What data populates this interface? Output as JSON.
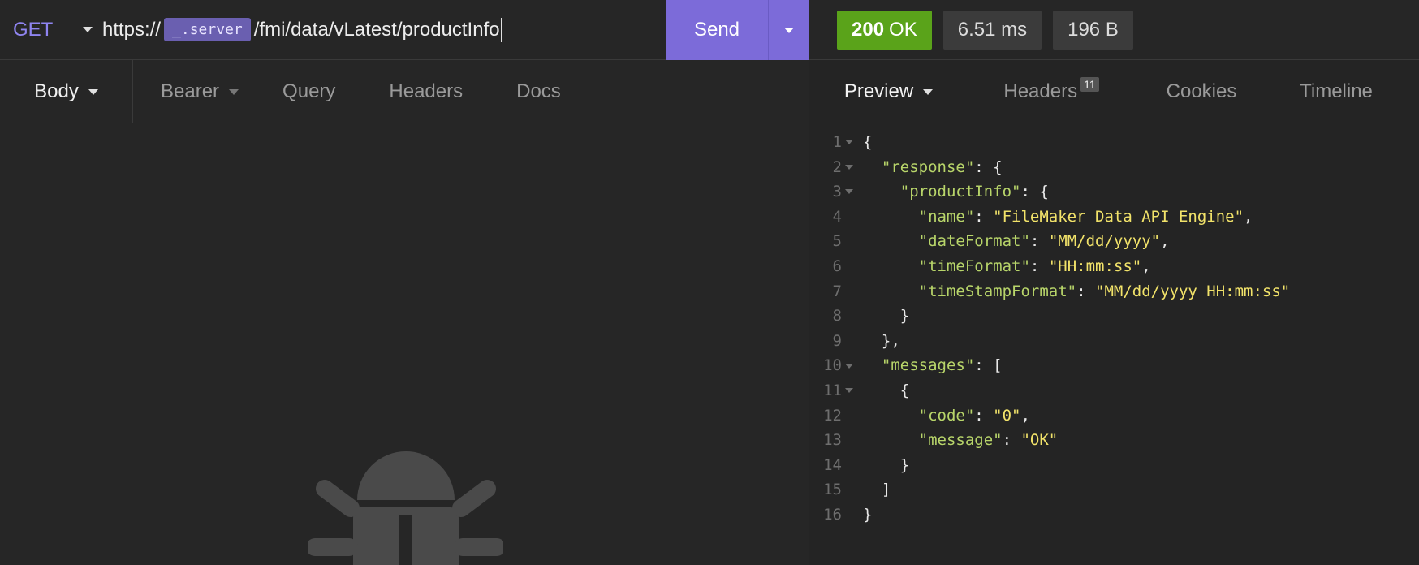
{
  "request": {
    "method": "GET",
    "url_prefix": "https://",
    "url_env": "_.server",
    "url_path": "/fmi/data/vLatest/productInfo",
    "send_label": "Send",
    "tabs": [
      "Body",
      "Bearer",
      "Query",
      "Headers",
      "Docs"
    ]
  },
  "response": {
    "status": {
      "code": "200",
      "text": "OK",
      "color": "#5aa31a"
    },
    "time": "6.51 ms",
    "size": "196 B",
    "tabs": {
      "preview": "Preview",
      "headers": "Headers",
      "headers_count": "11",
      "cookies": "Cookies",
      "timeline": "Timeline"
    },
    "lines": [
      {
        "n": "1",
        "fold": true,
        "text": "{"
      },
      {
        "n": "2",
        "fold": true,
        "indent": "  ",
        "key": "\"response\"",
        "rest": ": {"
      },
      {
        "n": "3",
        "fold": true,
        "indent": "    ",
        "key": "\"productInfo\"",
        "rest": ": {"
      },
      {
        "n": "4",
        "fold": false,
        "indent": "      ",
        "key": "\"name\"",
        "sep": ": ",
        "val": "\"FileMaker Data API Engine\"",
        "tail": ","
      },
      {
        "n": "5",
        "fold": false,
        "indent": "      ",
        "key": "\"dateFormat\"",
        "sep": ": ",
        "val": "\"MM/dd/yyyy\"",
        "tail": ","
      },
      {
        "n": "6",
        "fold": false,
        "indent": "      ",
        "key": "\"timeFormat\"",
        "sep": ": ",
        "val": "\"HH:mm:ss\"",
        "tail": ","
      },
      {
        "n": "7",
        "fold": false,
        "indent": "      ",
        "key": "\"timeStampFormat\"",
        "sep": ": ",
        "val": "\"MM/dd/yyyy HH:mm:ss\"",
        "tail": ""
      },
      {
        "n": "8",
        "fold": false,
        "text": "    }"
      },
      {
        "n": "9",
        "fold": false,
        "text": "  },"
      },
      {
        "n": "10",
        "fold": true,
        "indent": "  ",
        "key": "\"messages\"",
        "rest": ": ["
      },
      {
        "n": "11",
        "fold": true,
        "text": "    {"
      },
      {
        "n": "12",
        "fold": false,
        "indent": "      ",
        "key": "\"code\"",
        "sep": ": ",
        "val": "\"0\"",
        "tail": ","
      },
      {
        "n": "13",
        "fold": false,
        "indent": "      ",
        "key": "\"message\"",
        "sep": ": ",
        "val": "\"OK\"",
        "tail": ""
      },
      {
        "n": "14",
        "fold": false,
        "text": "    }"
      },
      {
        "n": "15",
        "fold": false,
        "text": "  ]"
      },
      {
        "n": "16",
        "fold": false,
        "text": "}"
      }
    ]
  },
  "icons": {
    "empty_state": "bug-icon"
  }
}
